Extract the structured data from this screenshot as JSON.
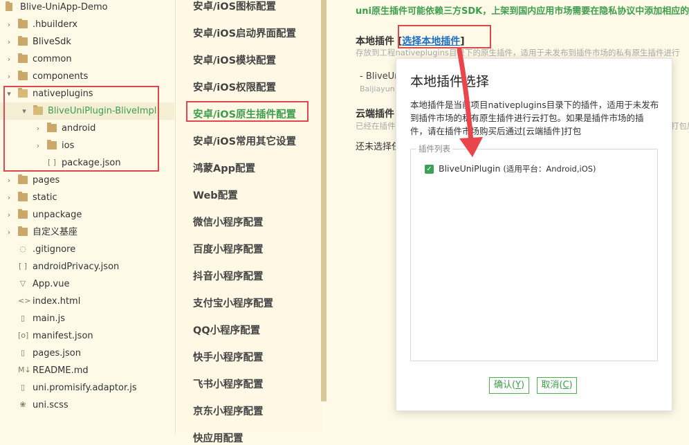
{
  "tree": {
    "items": [
      {
        "label": "Blive-UniApp-Demo",
        "kind": "root"
      },
      {
        "label": ".hbuilderx",
        "kind": "folder"
      },
      {
        "label": "BliveSdk",
        "kind": "folder"
      },
      {
        "label": "common",
        "kind": "folder"
      },
      {
        "label": "components",
        "kind": "folder"
      },
      {
        "label": "nativeplugins",
        "kind": "folder-open"
      },
      {
        "label": "BliveUniPlugin-BliveImpl",
        "kind": "folder-open"
      },
      {
        "label": "android",
        "kind": "folder"
      },
      {
        "label": "ios",
        "kind": "folder"
      },
      {
        "label": "package.json",
        "kind": "file"
      },
      {
        "label": "pages",
        "kind": "folder"
      },
      {
        "label": "static",
        "kind": "folder"
      },
      {
        "label": "unpackage",
        "kind": "folder"
      },
      {
        "label": "自定义基座",
        "kind": "folder"
      },
      {
        "label": ".gitignore",
        "kind": "file"
      },
      {
        "label": "androidPrivacy.json",
        "kind": "file"
      },
      {
        "label": "App.vue",
        "kind": "file"
      },
      {
        "label": "index.html",
        "kind": "file"
      },
      {
        "label": "main.js",
        "kind": "file"
      },
      {
        "label": "manifest.json",
        "kind": "file"
      },
      {
        "label": "pages.json",
        "kind": "file"
      },
      {
        "label": "README.md",
        "kind": "file"
      },
      {
        "label": "uni.promisify.adaptor.js",
        "kind": "file"
      },
      {
        "label": "uni.scss",
        "kind": "file"
      }
    ]
  },
  "nav": {
    "items": [
      "安卓/iOS图标配置",
      "安卓/iOS启动界面配置",
      "安卓/iOS模块配置",
      "安卓/iOS权限配置",
      "安卓/iOS原生插件配置",
      "安卓/iOS常用其它设置",
      "鸿蒙App配置",
      "Web配置",
      "微信小程序配置",
      "百度小程序配置",
      "抖音小程序配置",
      "支付宝小程序配置",
      "QQ小程序配置",
      "快手小程序配置",
      "飞书小程序配置",
      "京东小程序配置",
      "快应用配置"
    ],
    "active_index": 4
  },
  "main": {
    "notice": "uni原生插件可能依赖三方SDK，上架到国内应用市场需要在隐私协议中添加相应的条",
    "local_label": "本地插件",
    "local_link": "选择本地插件",
    "local_desc": "存放到工程nativeplugins目录下的原生插件，适用于未发布到插件市场的私有原生插件进行",
    "local_item": "- BliveUn",
    "local_item_sub": "Baijiayun",
    "cloud_label": "云端插件",
    "cloud_desc": "已经在插件",
    "cloud_desc_right": "打包后",
    "none_selected": "还未选择任"
  },
  "dialog": {
    "title": "本地插件选择",
    "description": "本地插件是当前项目nativeplugins目录下的插件，适用于未发布到插件市场的私有原生插件进行云打包。如果是插件市场的插件，请在插件市场购买后通过[云端插件]打包",
    "legend": "插件列表",
    "plugin_name": "BliveUniPlugin",
    "plugin_platform": "(适用平台：Android,iOS)",
    "confirm_text": "确认(",
    "confirm_key": "Y",
    "cancel_text": "取消(",
    "cancel_key": "C",
    "close_paren": ")"
  },
  "colors": {
    "accent_green": "#3f9e4d",
    "highlight_red": "#e0474c",
    "link_blue": "#1a6fc4"
  }
}
